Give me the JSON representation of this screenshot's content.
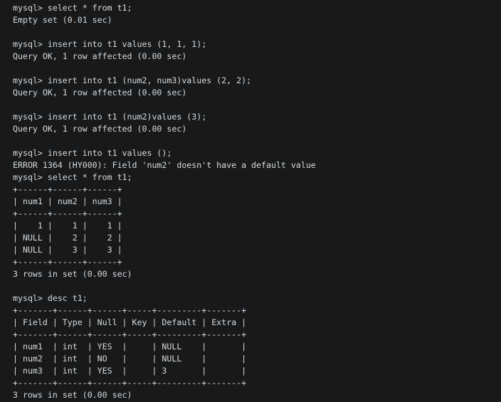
{
  "window": {
    "title": "mysql client session",
    "background_color": "#191919",
    "text_color": "#d6dadd",
    "prompt": "mysql>"
  },
  "terminal": {
    "lines": [
      "mysql> select * from t1;",
      "Empty set (0.01 sec)",
      "",
      "mysql> insert into t1 values (1, 1, 1);",
      "Query OK, 1 row affected (0.00 sec)",
      "",
      "mysql> insert into t1 (num2, num3)values (2, 2);",
      "Query OK, 1 row affected (0.00 sec)",
      "",
      "mysql> insert into t1 (num2)values (3);",
      "Query OK, 1 row affected (0.00 sec)",
      "",
      "mysql> insert into t1 values ();",
      "ERROR 1364 (HY000): Field 'num2' doesn't have a default value",
      "mysql> select * from t1;",
      "+------+------+------+",
      "| num1 | num2 | num3 |",
      "+------+------+------+",
      "|    1 |    1 |    1 |",
      "| NULL |    2 |    2 |",
      "| NULL |    3 |    3 |",
      "+------+------+------+",
      "3 rows in set (0.00 sec)",
      "",
      "mysql> desc t1;",
      "+-------+------+------+-----+---------+-------+",
      "| Field | Type | Null | Key | Default | Extra |",
      "+-------+------+------+-----+---------+-------+",
      "| num1  | int  | YES  |     | NULL    |       |",
      "| num2  | int  | NO   |     | NULL    |       |",
      "| num3  | int  | YES  |     | 3       |       |",
      "+-------+------+------+-----+---------+-------+",
      "3 rows in set (0.00 sec)"
    ],
    "commands": [
      "select * from t1;",
      "insert into t1 values (1, 1, 1);",
      "insert into t1 (num2, num3)values (2, 2);",
      "insert into t1 (num2)values (3);",
      "insert into t1 values ();",
      "select * from t1;",
      "desc t1;"
    ],
    "results": {
      "empty_set": "Empty set (0.01 sec)",
      "query_ok": "Query OK, 1 row affected (0.00 sec)",
      "error": "ERROR 1364 (HY000): Field 'num2' doesn't have a default value",
      "rows_in_set": "3 rows in set (0.00 sec)"
    },
    "select_table": {
      "columns": [
        "num1",
        "num2",
        "num3"
      ],
      "rows": [
        [
          "1",
          "1",
          "1"
        ],
        [
          "NULL",
          "2",
          "2"
        ],
        [
          "NULL",
          "3",
          "3"
        ]
      ],
      "footer": "3 rows in set (0.00 sec)"
    },
    "desc_table": {
      "columns": [
        "Field",
        "Type",
        "Null",
        "Key",
        "Default",
        "Extra"
      ],
      "rows": [
        [
          "num1",
          "int",
          "YES",
          "",
          "NULL",
          ""
        ],
        [
          "num2",
          "int",
          "NO",
          "",
          "NULL",
          ""
        ],
        [
          "num3",
          "int",
          "YES",
          "",
          "3",
          ""
        ]
      ],
      "footer": "3 rows in set (0.00 sec)"
    }
  }
}
